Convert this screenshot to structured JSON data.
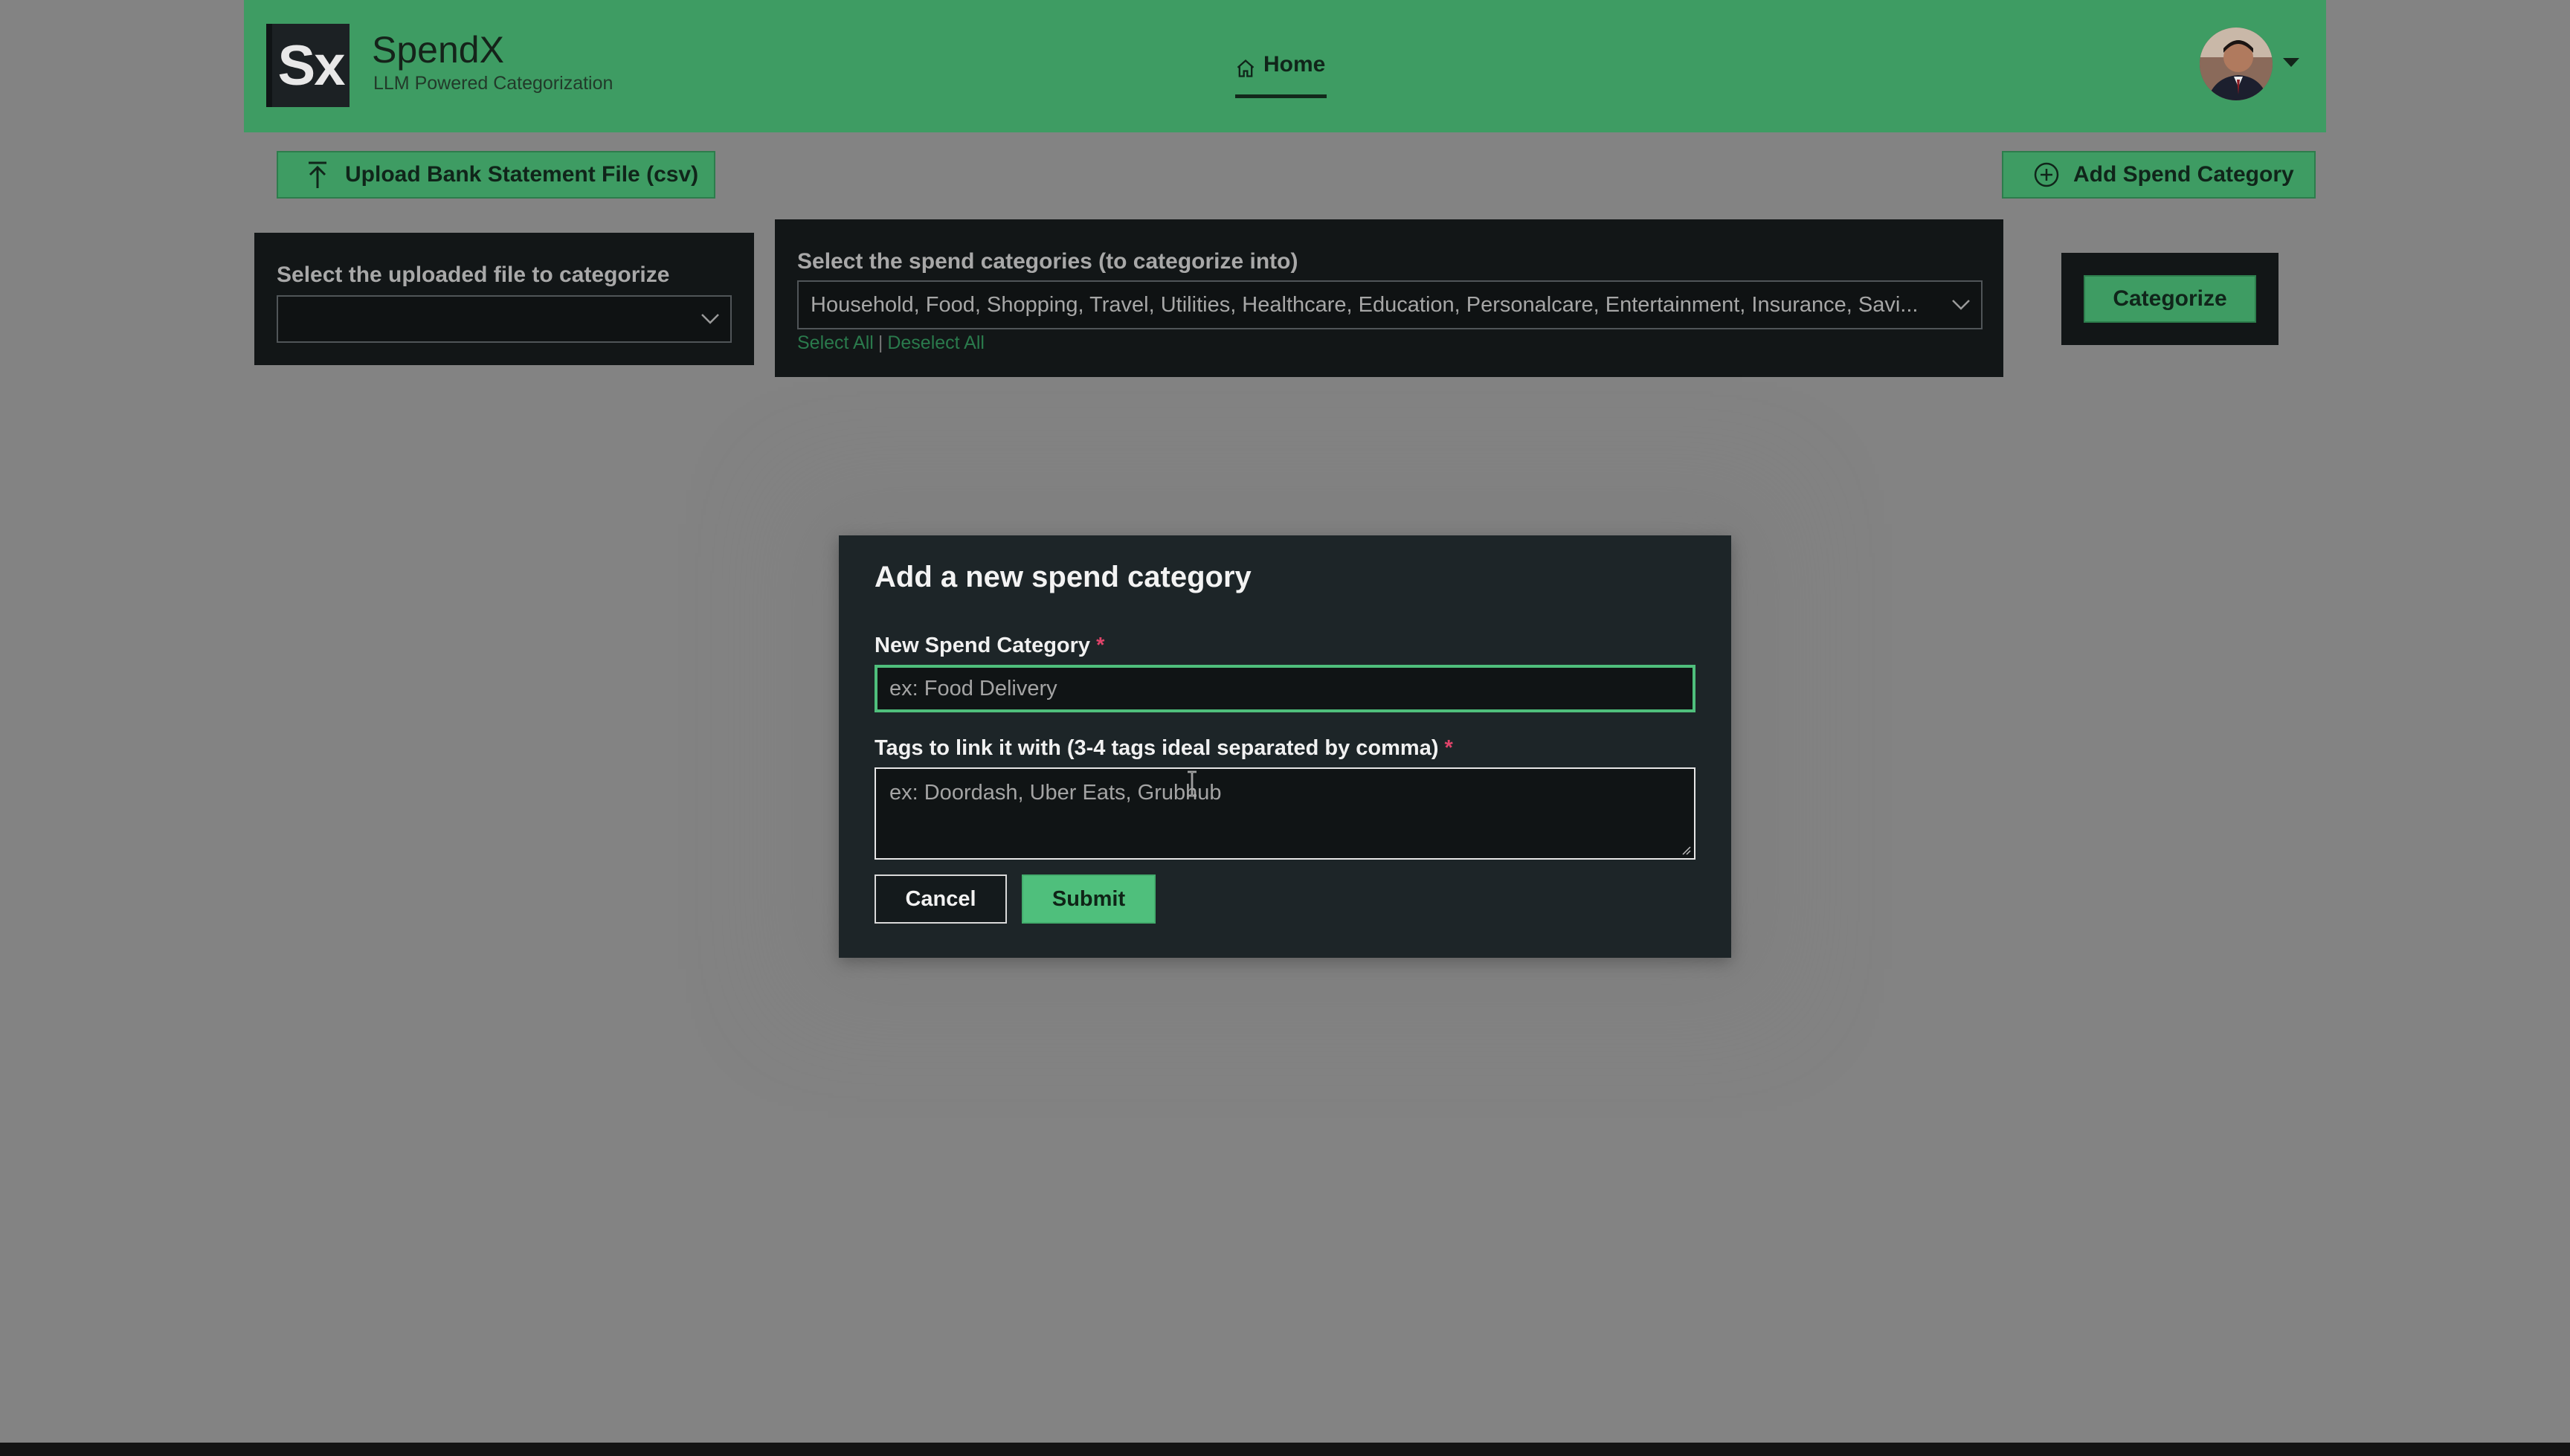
{
  "header": {
    "logo_text": "Sx",
    "brand_name": "SpendX",
    "brand_subtitle": "LLM Powered Categorization",
    "nav_home": "Home"
  },
  "actions": {
    "upload_label": "Upload Bank Statement File (csv)",
    "add_category_label": "Add Spend Category"
  },
  "file_panel": {
    "label": "Select the uploaded file to categorize",
    "selected_value": ""
  },
  "categories_panel": {
    "label": "Select the spend categories (to categorize into)",
    "selected_value": "Household, Food, Shopping, Travel, Utilities, Healthcare, Education, Personalcare, Entertainment, Insurance, Savi...",
    "select_all": "Select All",
    "separator": "|",
    "deselect_all": "Deselect All"
  },
  "categorize_label": "Categorize",
  "modal": {
    "title": "Add a new spend category",
    "category_label": "New Spend Category",
    "required_mark": "*",
    "category_placeholder": "ex: Food Delivery",
    "tags_label": "Tags to link it with (3-4 tags ideal separated by comma)",
    "tags_placeholder": "ex: Doordash, Uber Eats, Grubhub",
    "cancel_label": "Cancel",
    "submit_label": "Submit"
  },
  "colors": {
    "brand_green": "#3e9c63",
    "accent_green": "#4fbf7c",
    "panel_dark": "#121617",
    "required_red": "#e0446a"
  }
}
